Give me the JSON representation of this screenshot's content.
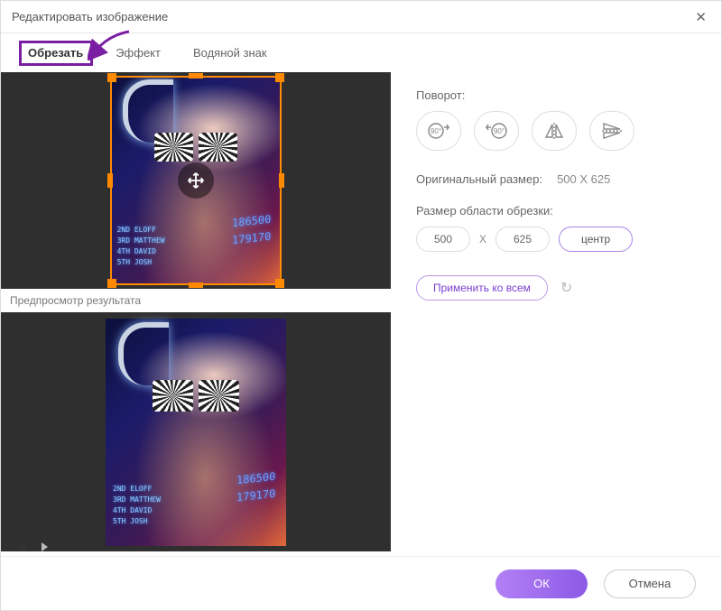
{
  "titlebar": {
    "title": "Редактировать изображение"
  },
  "tabs": {
    "crop": "Обрезать",
    "effect": "Эффект",
    "watermark": "Водяной знак",
    "active": "crop"
  },
  "preview_label": "Предпросмотр результата",
  "rotate": {
    "label": "Поворот:",
    "cw_label": "90°",
    "ccw_label": "90°"
  },
  "original": {
    "label": "Оригинальный размер:",
    "value": "500 X 625"
  },
  "crop_area": {
    "label": "Размер области обрезки:",
    "width": "500",
    "height": "625",
    "x_sep": "X",
    "center_btn": "центр"
  },
  "apply_all_btn": "Применить ко всем",
  "footer": {
    "ok": "ОК",
    "cancel": "Отмена"
  },
  "image_decoration": {
    "neon_names": "2ND ELOFF\n3RD MATTHEW\n4TH DAVID\n5TH JOSH",
    "neon_numbers": "186500\n179170"
  }
}
